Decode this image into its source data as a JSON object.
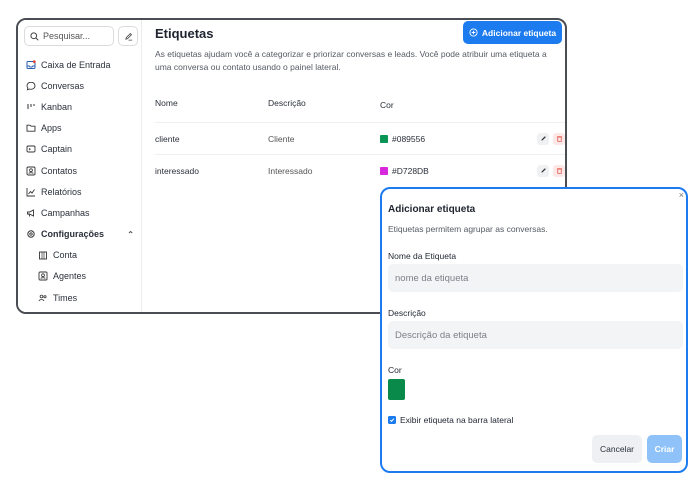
{
  "sidebar": {
    "search_placeholder": "Pesquisar...",
    "items": [
      {
        "label": "Caixa de Entrada",
        "icon": "inbox-icon"
      },
      {
        "label": "Conversas",
        "icon": "chat-icon"
      },
      {
        "label": "Kanban",
        "icon": "kanban-icon"
      },
      {
        "label": "Apps",
        "icon": "folder-icon"
      },
      {
        "label": "Captain",
        "icon": "captain-icon"
      },
      {
        "label": "Contatos",
        "icon": "contacts-icon"
      },
      {
        "label": "Relatórios",
        "icon": "chart-icon"
      },
      {
        "label": "Campanhas",
        "icon": "megaphone-icon"
      },
      {
        "label": "Configurações",
        "icon": "gear-icon"
      }
    ],
    "sub_items": [
      {
        "label": "Conta",
        "icon": "building-icon"
      },
      {
        "label": "Agentes",
        "icon": "agent-icon"
      },
      {
        "label": "Times",
        "icon": "team-icon"
      }
    ]
  },
  "main": {
    "title": "Etiquetas",
    "add_button": "Adicionar etiqueta",
    "description": "As etiquetas ajudam você a categorizar e priorizar conversas e leads. Você pode atribuir uma etiqueta a uma conversa ou contato usando o painel lateral.",
    "table": {
      "headers": [
        "Nome",
        "Descrição",
        "Cor"
      ],
      "rows": [
        {
          "name": "cliente",
          "description": "Cliente",
          "color": "#089556"
        },
        {
          "name": "interessado",
          "description": "Interessado",
          "color": "#D728DB"
        }
      ]
    }
  },
  "modal": {
    "close": "×",
    "title": "Adicionar etiqueta",
    "subtitle": "Etiquetas permitem agrupar as conversas.",
    "name_label": "Nome da Etiqueta",
    "name_placeholder": "nome da etiqueta",
    "desc_label": "Descrição",
    "desc_placeholder": "Descrição da etiqueta",
    "color_label": "Cor",
    "color_value": "#0a8a4a",
    "checkbox_label": "Exibir etiqueta na barra lateral",
    "checkbox_checked": true,
    "cancel": "Cancelar",
    "create": "Criar"
  },
  "colors": {
    "accent": "#1d7bf0",
    "accent_disabled": "#8ec2f8"
  }
}
